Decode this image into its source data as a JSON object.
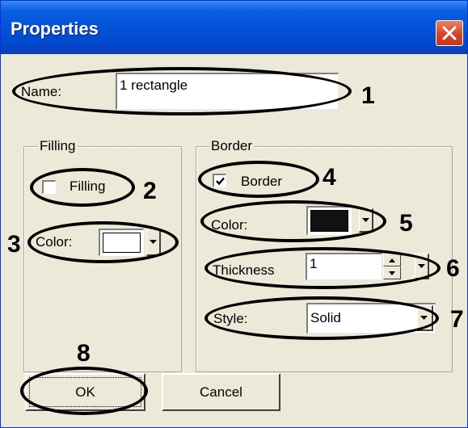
{
  "window": {
    "title": "Properties"
  },
  "name_field": {
    "label": "Name:",
    "value": "1 rectangle"
  },
  "filling_group": {
    "legend": "Filling",
    "checkbox_label": "Filling",
    "checked": false,
    "color_label": "Color:",
    "color": "#ffffff"
  },
  "border_group": {
    "legend": "Border",
    "checkbox_label": "Border",
    "checked": true,
    "color_label": "Color:",
    "color": "#111111",
    "thickness_label": "Thickness",
    "thickness_value": "1",
    "style_label": "Style:",
    "style_value": "Solid"
  },
  "buttons": {
    "ok": "OK",
    "cancel": "Cancel"
  },
  "annotations": [
    "1",
    "2",
    "3",
    "4",
    "5",
    "6",
    "7",
    "8"
  ]
}
